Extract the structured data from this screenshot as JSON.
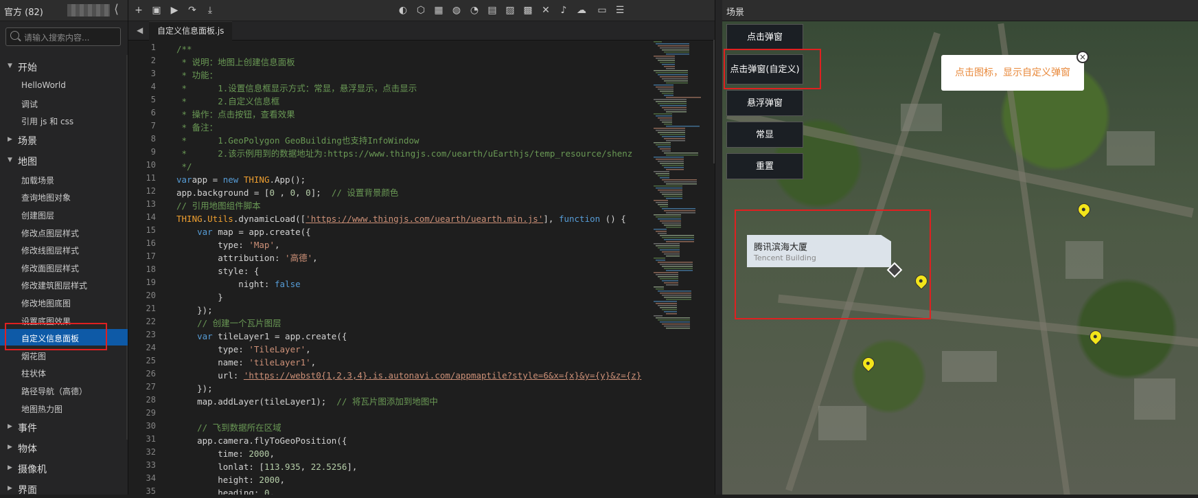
{
  "sidebar": {
    "title": "官方 (82)",
    "search_placeholder": "请输入搜索内容...",
    "groups": [
      {
        "label": "开始",
        "items": [
          "HelloWorld",
          "调试",
          "引用 js 和 css"
        ]
      },
      {
        "label": "场景"
      },
      {
        "label": "地图",
        "items": [
          "加载场景",
          "查询地图对象",
          "创建图层",
          "修改点图层样式",
          "修改线图层样式",
          "修改面图层样式",
          "修改建筑图层样式",
          "修改地图底图",
          "设置底图效果",
          "自定义信息面板",
          "烟花图",
          "柱状体",
          "路径导航（高德）",
          "地图热力图"
        ]
      },
      {
        "label": "事件"
      },
      {
        "label": "物体"
      },
      {
        "label": "摄像机"
      },
      {
        "label": "界面"
      }
    ],
    "active_item": "自定义信息面板"
  },
  "editor": {
    "tab": "自定义信息面板.js",
    "toolbar_icons": [
      "add-icon",
      "save-icon",
      "run-icon",
      "share-icon",
      "download-icon",
      "theme-icon",
      "cube-icon",
      "building-icon",
      "globe-icon",
      "chart-icon",
      "layout-icon",
      "image-icon",
      "picture-icon",
      "connect-icon",
      "music-icon",
      "cloud-icon",
      "doc-icon",
      "settings-icon"
    ],
    "line_numbers": [
      "1",
      "2",
      "3",
      "4",
      "5",
      "6",
      "7",
      "8",
      "9",
      "10",
      "11",
      "12",
      "13",
      "14",
      "15",
      "16",
      "17",
      "18",
      "19",
      "20",
      "21",
      "22",
      "23",
      "24",
      "25",
      "26",
      "27",
      "28",
      "29",
      "30",
      "31",
      "32",
      "33",
      "34",
      "35"
    ],
    "lines": [
      [
        [
          "cm",
          "/**"
        ]
      ],
      [
        [
          "cm",
          " * 说明：地图上创建信息面板"
        ]
      ],
      [
        [
          "cm",
          " * 功能："
        ]
      ],
      [
        [
          "cm",
          " *      1.设置信息框显示方式：常显，悬浮显示，点击显示"
        ]
      ],
      [
        [
          "cm",
          " *      2.自定义信息框"
        ]
      ],
      [
        [
          "cm",
          " * 操作：点击按钮，查看效果"
        ]
      ],
      [
        [
          "cm",
          " * 备注："
        ]
      ],
      [
        [
          "cm",
          " *      1.GeoPolygon GeoBuilding也支持InfoWindow"
        ]
      ],
      [
        [
          "cm",
          " *      2.该示例用到的数据地址为:"
        ],
        [
          "cm",
          "https://www.thingjs.com/uearth/uEarthjs/temp_resource/shenz"
        ]
      ],
      [
        [
          "cm",
          " */"
        ]
      ],
      [
        [
          "kw",
          "var"
        ],
        [
          "",
          "app = "
        ],
        [
          "kw",
          "new "
        ],
        [
          "cls",
          "THING"
        ],
        [
          "",
          ".App();"
        ]
      ],
      [
        [
          "",
          "app.background = ["
        ],
        [
          "nu",
          "0"
        ],
        [
          "",
          " , "
        ],
        [
          "nu",
          "0"
        ],
        [
          "",
          ", "
        ],
        [
          "nu",
          "0"
        ],
        [
          "",
          "];  "
        ],
        [
          "cm",
          "// 设置背景颜色"
        ]
      ],
      [
        [
          "cm",
          "// 引用地图组件脚本"
        ]
      ],
      [
        [
          "cls",
          "THING"
        ],
        [
          "",
          "."
        ],
        [
          "cls",
          "Utils"
        ],
        [
          "",
          ".dynamicLoad(["
        ],
        [
          "ur",
          "'https://www.thingjs.com/uearth/uearth.min.js'"
        ],
        [
          "",
          "], "
        ],
        [
          "kw",
          "function"
        ],
        [
          "",
          " () {"
        ]
      ],
      [
        [
          "",
          "    "
        ],
        [
          "kw",
          "var"
        ],
        [
          "",
          " map = app.create({"
        ]
      ],
      [
        [
          "",
          "        type: "
        ],
        [
          "st",
          "'Map'"
        ],
        [
          "",
          ","
        ]
      ],
      [
        [
          "",
          "        attribution: "
        ],
        [
          "st",
          "'高德'"
        ],
        [
          "",
          ","
        ]
      ],
      [
        [
          "",
          "        style: {"
        ]
      ],
      [
        [
          "",
          "            night: "
        ],
        [
          "kw",
          "false"
        ]
      ],
      [
        [
          "",
          "        }"
        ]
      ],
      [
        [
          "",
          "    });"
        ]
      ],
      [
        [
          "",
          "    "
        ],
        [
          "cm",
          "// 创建一个瓦片图层"
        ]
      ],
      [
        [
          "",
          "    "
        ],
        [
          "kw",
          "var"
        ],
        [
          "",
          " tileLayer1 = app.create({"
        ]
      ],
      [
        [
          "",
          "        type: "
        ],
        [
          "st",
          "'TileLayer'"
        ],
        [
          "",
          ","
        ]
      ],
      [
        [
          "",
          "        name: "
        ],
        [
          "st",
          "'tileLayer1'"
        ],
        [
          "",
          ","
        ]
      ],
      [
        [
          "",
          "        url: "
        ],
        [
          "ur",
          "'https://webst0{1,2,3,4}.is.autonavi.com/appmaptile?style=6&x={x}&y={y}&z={z}"
        ]
      ],
      [
        [
          "",
          "    });"
        ]
      ],
      [
        [
          "",
          "    map.addLayer(tileLayer1);  "
        ],
        [
          "cm",
          "// 将瓦片图添加到地图中"
        ]
      ],
      [
        [
          "",
          " "
        ]
      ],
      [
        [
          "",
          "    "
        ],
        [
          "cm",
          "// 飞到数据所在区域"
        ]
      ],
      [
        [
          "",
          "    app.camera.flyToGeoPosition({"
        ]
      ],
      [
        [
          "",
          "        time: "
        ],
        [
          "nu",
          "2000"
        ],
        [
          "",
          ","
        ]
      ],
      [
        [
          "",
          "        lonlat: ["
        ],
        [
          "nu",
          "113.935"
        ],
        [
          "",
          ", "
        ],
        [
          "nu",
          "22.5256"
        ],
        [
          "",
          "],"
        ]
      ],
      [
        [
          "",
          "        height: "
        ],
        [
          "nu",
          "2000"
        ],
        [
          "",
          ","
        ]
      ],
      [
        [
          "",
          "        heading: "
        ],
        [
          "nu",
          "0"
        ],
        [
          "",
          ","
        ]
      ]
    ]
  },
  "scene": {
    "title": "场景",
    "buttons": [
      "点击弹窗",
      "点击弹窗(自定义)",
      "悬浮弹窗",
      "常显",
      "重置"
    ],
    "popup_text": "点击图标，显示自定义弹窗",
    "popup_close": "×",
    "info_cn": "腾讯滨海大厦",
    "info_en": "Tencent Building"
  }
}
